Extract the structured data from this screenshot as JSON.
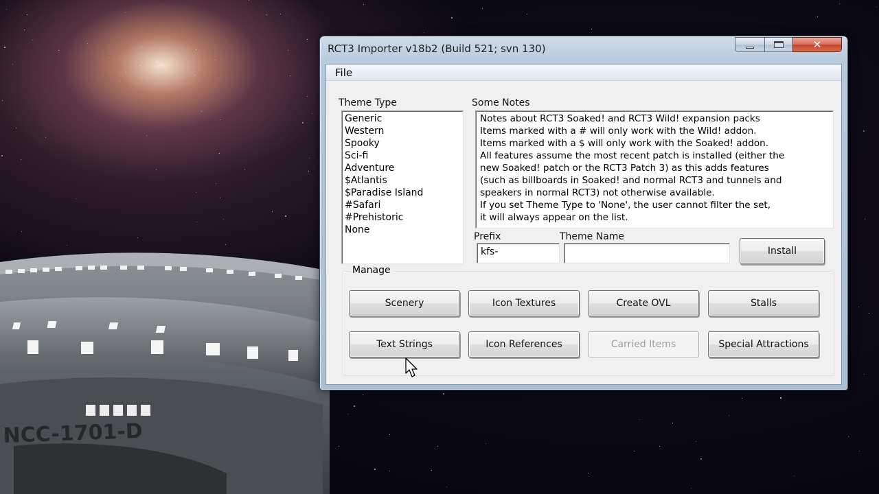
{
  "window": {
    "title": "RCT3 Importer v18b2 (Build 521; svn 130)",
    "close_glyph": "✕"
  },
  "menu": {
    "file": "File"
  },
  "theme_type": {
    "label": "Theme Type",
    "items": [
      "Generic",
      "Western",
      "Spooky",
      "Sci-fi",
      "Adventure",
      "$Atlantis",
      "$Paradise Island",
      "#Safari",
      "#Prehistoric",
      "None"
    ]
  },
  "notes": {
    "label": "Some Notes",
    "lines": [
      "Notes about RCT3 Soaked! and RCT3 Wild! expansion packs",
      "Items marked with a # will only work with the Wild! addon.",
      "Items marked with a $ will only work with the Soaked! addon.",
      "All features assume the most recent patch is installed (either the",
      "new Soaked! patch or the RCT3 Patch 3) as this adds features",
      "(such as billboards in Soaked! and normal RCT3 and tunnels and",
      "speakers in normal RCT3) not otherwise available.",
      "If you set Theme Type to 'None', the user cannot filter the set,",
      "it will always appear on the list."
    ]
  },
  "prefix": {
    "label": "Prefix",
    "value": "kfs-"
  },
  "theme_name": {
    "label": "Theme Name",
    "value": ""
  },
  "install_label": "Install",
  "manage": {
    "label": "Manage",
    "buttons": [
      {
        "label": "Scenery",
        "enabled": true
      },
      {
        "label": "Icon Textures",
        "enabled": true
      },
      {
        "label": "Create OVL",
        "enabled": true
      },
      {
        "label": "Stalls",
        "enabled": true
      },
      {
        "label": "Text Strings",
        "enabled": true
      },
      {
        "label": "Icon References",
        "enabled": true
      },
      {
        "label": "Carried Items",
        "enabled": false
      },
      {
        "label": "Special Attractions",
        "enabled": true
      }
    ]
  },
  "ship_hull_text": "NCC-1701-D",
  "colors": {
    "window_frame": "#b7c9dd",
    "client_bg": "#f0f0f0",
    "close_button": "#c4432a",
    "disabled_text": "#9d9d9d"
  },
  "icons": {
    "minimize": "minimize-icon",
    "maximize": "maximize-icon",
    "close": "close-icon",
    "cursor": "mouse-pointer-icon"
  }
}
